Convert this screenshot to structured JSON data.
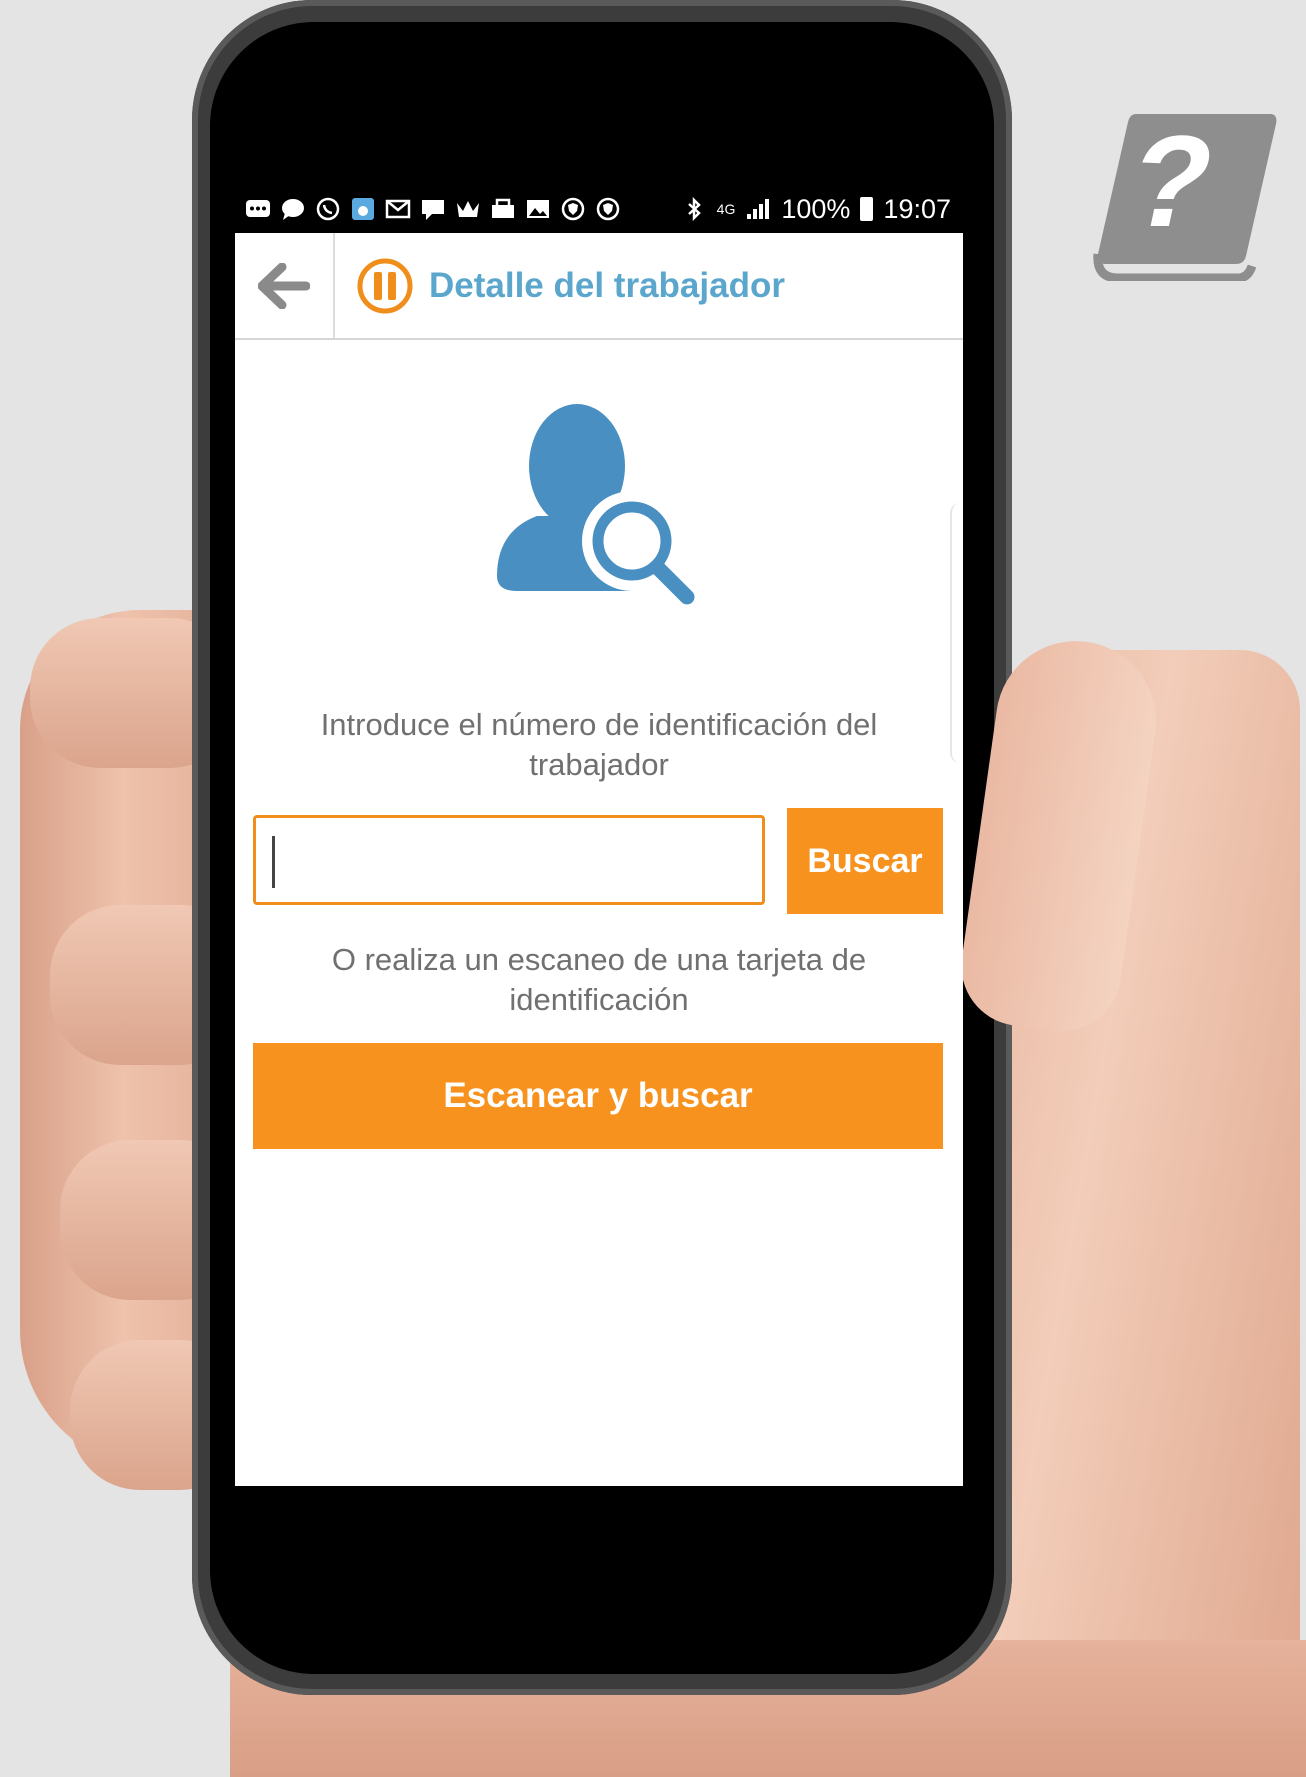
{
  "status_bar": {
    "battery": "100%",
    "time": "19:07",
    "network": "4G",
    "icons": [
      "more-icon",
      "chat-icon",
      "whatsapp-icon",
      "app-icon",
      "mail-icon",
      "message-icon",
      "crown-icon",
      "inbox-icon",
      "gallery-icon",
      "vpn-icon",
      "vpn-icon",
      "bluetooth-icon",
      "signal-icon"
    ]
  },
  "app_bar": {
    "title": "Detalle del trabajador"
  },
  "search": {
    "instruction": "Introduce el número de identificación del trabajador",
    "input_value": "",
    "button_label": "Buscar"
  },
  "scan": {
    "instruction": "O realiza un escaneo de una tarjeta de identificación",
    "button_label": "Escanear y buscar"
  },
  "colors": {
    "accent_orange": "#f7921e",
    "title_blue": "#5ba6cc",
    "icon_blue": "#4a8fc2",
    "help_icon_gray": "#8e8e8e"
  }
}
